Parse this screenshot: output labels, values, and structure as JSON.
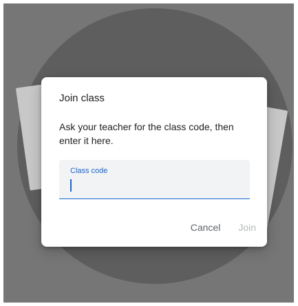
{
  "dialog": {
    "title": "Join class",
    "body": "Ask your teacher for the class code, then enter it here.",
    "field": {
      "label": "Class code",
      "value": ""
    },
    "actions": {
      "cancel_label": "Cancel",
      "join_label": "Join",
      "join_enabled": false
    }
  },
  "colors": {
    "accent": "#1967d2",
    "text": "#202124",
    "muted_text": "#5f6368",
    "disabled_text": "#b6b8bb",
    "field_background": "#f1f3f4",
    "scrim": "#767676"
  }
}
